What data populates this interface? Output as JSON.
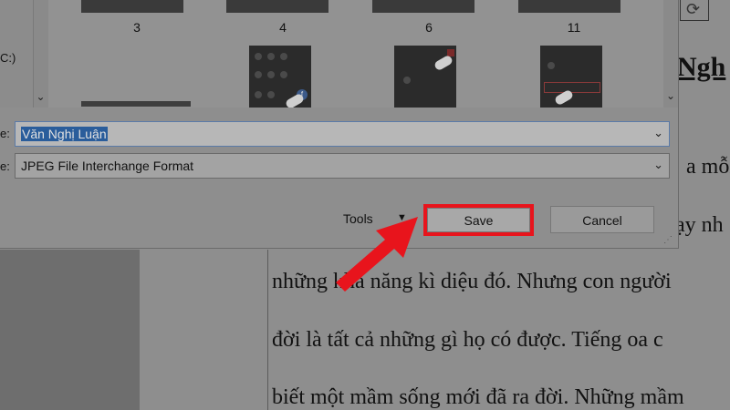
{
  "document": {
    "heading_fragment": "Ngh",
    "lines": [
      "những khả năng kì diệu đó. Nhưng con người",
      "đời là tất cả những gì họ có được. Tiếng oa c",
      "biết một mầm sống mới đã ra đời. Những mầm"
    ],
    "right_fragments": [
      "a mỗi",
      "ạy nh"
    ]
  },
  "dialog": {
    "nav_label": "C:)",
    "thumbnails": [
      {
        "caption": "3"
      },
      {
        "caption": "4"
      },
      {
        "caption": "6"
      },
      {
        "caption": "11"
      }
    ],
    "file_name_label": "e:",
    "file_name_value": "Văn Nghị Luận",
    "file_type_label": "e:",
    "file_type_value": "JPEG File Interchange Format",
    "tools_label": "Tools",
    "save_label": "Save",
    "cancel_label": "Cancel"
  },
  "colors": {
    "highlight_red": "#e8141c",
    "selection_blue": "#2a5d9b"
  },
  "icons": {
    "chevron": "chevron-down-icon",
    "rotate": "rotate-icon",
    "arrow": "red-arrow-icon"
  }
}
